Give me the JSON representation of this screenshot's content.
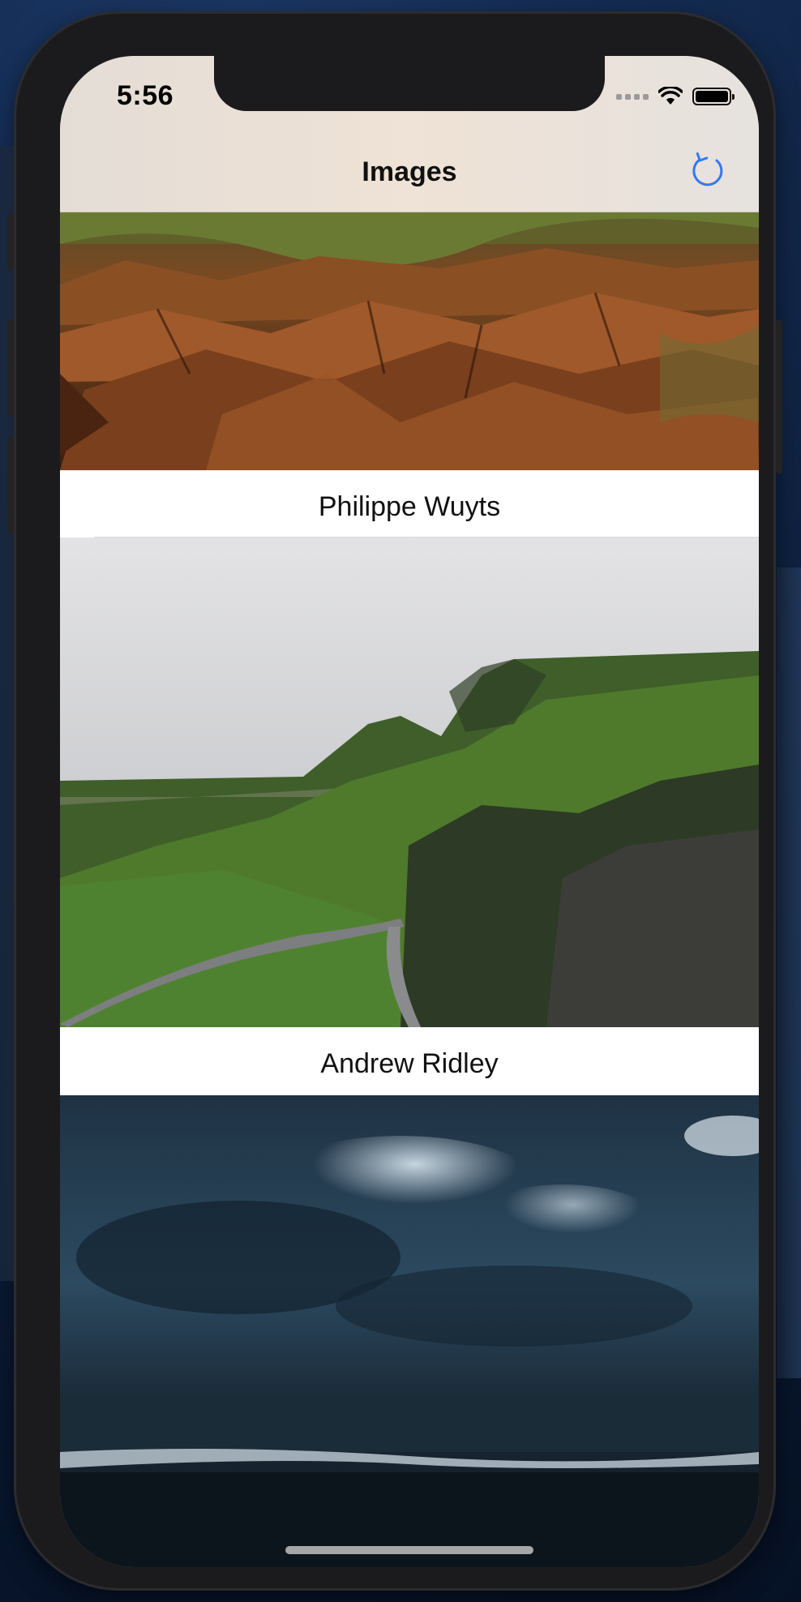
{
  "status_bar": {
    "time": "5:56",
    "icons": [
      "cellular-icon",
      "wifi-icon",
      "battery-icon"
    ]
  },
  "nav": {
    "title": "Images",
    "refresh_icon": "refresh-icon"
  },
  "colors": {
    "accent": "#3478f6",
    "header_bg": "#ece2d8"
  },
  "images": [
    {
      "author": "Philippe Wuyts",
      "subject": "rocks"
    },
    {
      "author": "Andrew Ridley",
      "subject": "green hills"
    },
    {
      "author": "",
      "subject": "stormy sea"
    }
  ]
}
